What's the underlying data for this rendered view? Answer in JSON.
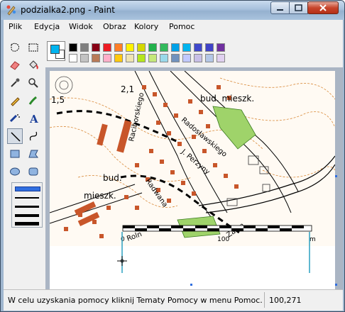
{
  "window": {
    "title": "podzialka2.png - Paint"
  },
  "menu": {
    "items": [
      "Plik",
      "Edycja",
      "Widok",
      "Obraz",
      "Kolory",
      "Pomoc"
    ]
  },
  "colors": {
    "foreground": "#00b4ef",
    "background": "#ffffff",
    "palette_row1": [
      "#000000",
      "#7f7f7f",
      "#880015",
      "#ed1c24",
      "#ff7f27",
      "#fff200",
      "#d4d800",
      "#22b14c",
      "#32ba5c",
      "#00a2e8",
      "#00b4ef",
      "#3f48cc",
      "#4043c8",
      "#7030a0"
    ],
    "palette_row2": [
      "#ffffff",
      "#c3c3c3",
      "#b97a57",
      "#ffaec9",
      "#ffc90e",
      "#efe4b0",
      "#b5e61d",
      "#c5e87a",
      "#99d9ea",
      "#7092be",
      "#c0c8ff",
      "#c8bfe7",
      "#b4c7e7",
      "#e0d0f0"
    ]
  },
  "map": {
    "labels": {
      "l1": "1,5",
      "l2": "2,1",
      "l3": "bud. mieszk.",
      "l4": "Raciborskiego",
      "l5": "Radosławskiego",
      "l6": "J. Perzyny",
      "l7": "bud.",
      "l8": "mieszk.",
      "l9": "Radwana",
      "l10": "Zasm",
      "l11": "Roln",
      "l12": "0",
      "l13": "100",
      "l14": "m"
    }
  },
  "status": {
    "help": "W celu uzyskania pomocy kliknij Tematy Pomocy w menu Pomoc.",
    "coords": "100,271"
  }
}
